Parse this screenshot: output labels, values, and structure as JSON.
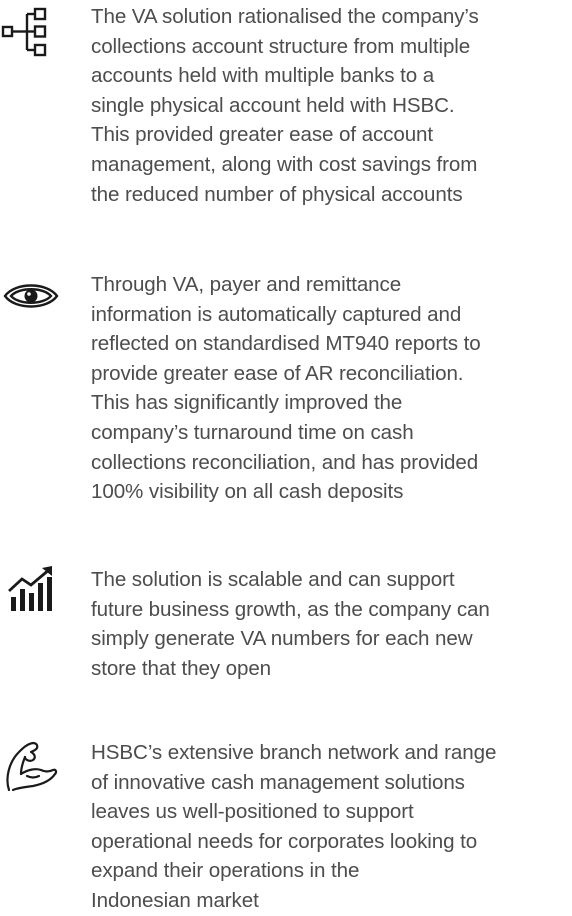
{
  "items": [
    {
      "icon": "hierarchy-tree-icon",
      "text": "The VA solution rationalised the company’s\ncollections account structure from multiple\naccounts held with multiple banks to a\nsingle physical account held with HSBC.\nThis provided greater ease of account\nmanagement, along with cost savings from\nthe reduced number of physical accounts"
    },
    {
      "icon": "eye-icon",
      "text": "Through VA, payer and remittance\ninformation is automatically captured and\nreflected on standardised MT940 reports to\nprovide greater ease of AR reconciliation.\nThis has significantly improved the\ncompany’s turnaround time on cash\ncollections reconciliation, and has provided\n100% visibility on all cash deposits"
    },
    {
      "icon": "growth-chart-icon",
      "text": "The solution is scalable and can support\nfuture business growth, as the company can\nsimply generate VA numbers for each new\nstore that they open"
    },
    {
      "icon": "flexed-arm-icon",
      "text": "HSBC’s extensive branch network and range\nof innovative cash management solutions\nleaves us well-positioned to support\noperational needs for corporates looking to\nexpand their operations in the\nIndonesian market"
    }
  ]
}
